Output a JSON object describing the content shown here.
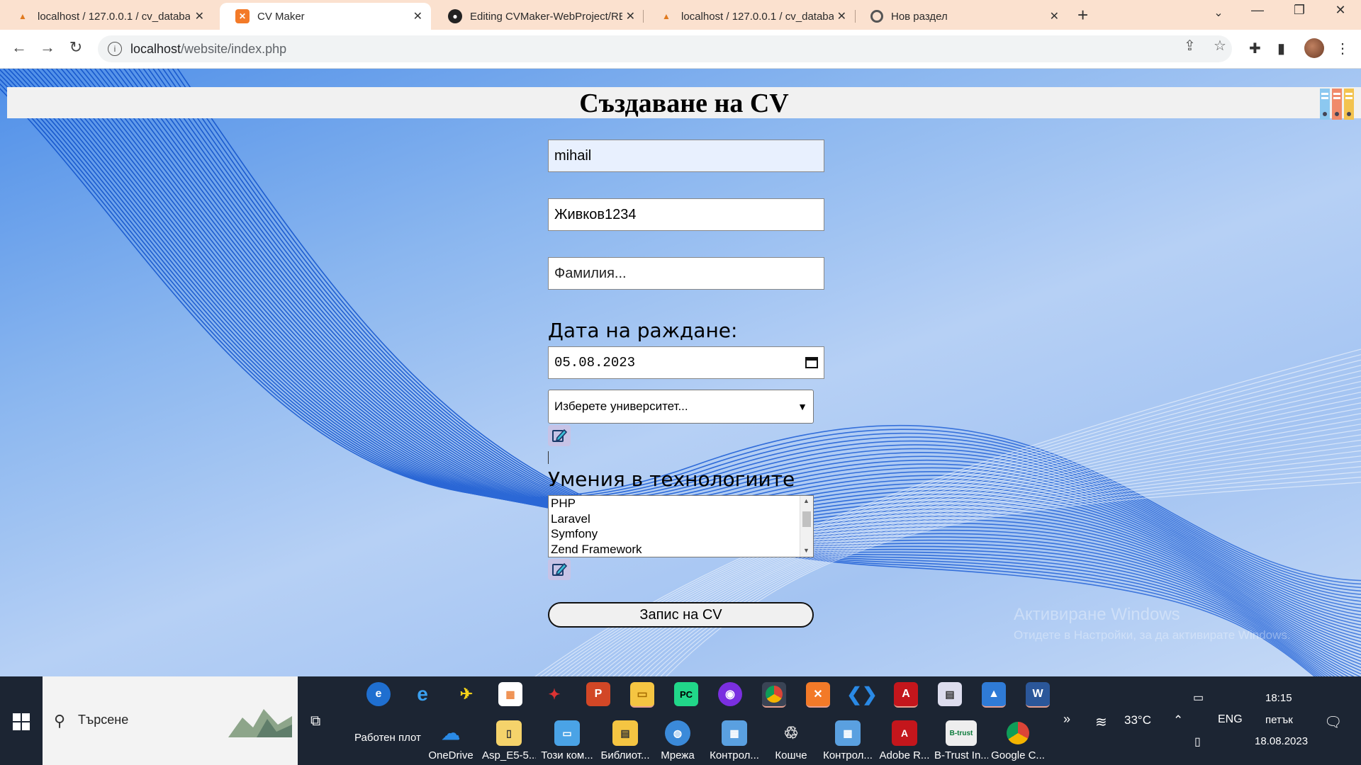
{
  "browser": {
    "tabs": [
      {
        "label": "localhost / 127.0.0.1 / cv_databas",
        "icon": "phpmyadmin-icon"
      },
      {
        "label": "CV Maker",
        "icon": "xampp-icon"
      },
      {
        "label": "Editing CVMaker-WebProject/RE",
        "icon": "github-icon"
      },
      {
        "label": "localhost / 127.0.0.1 / cv_databas",
        "icon": "phpmyadmin-icon"
      },
      {
        "label": "Нов раздел",
        "icon": "chrome-icon"
      }
    ],
    "url_host": "localhost",
    "url_path": "/website/index.php"
  },
  "page": {
    "title": "Създаване на CV",
    "first_name_value": "mihail",
    "middle_name_value": "Живков1234",
    "last_name_placeholder": "Фамилия...",
    "birth_label": "Дата на раждане:",
    "birth_value": "05.08.2023",
    "university_placeholder": "Изберете университет...",
    "skills_label": "Умения в технологиите",
    "skills": [
      "PHP",
      "Laravel",
      "Symfony",
      "Zend Framework"
    ],
    "submit_label": "Запис на CV",
    "watermark_title": "Активиране Windows",
    "watermark_sub": "Отидете в Настройки, за да активирате Windows."
  },
  "taskbar": {
    "search_placeholder": "Търсене",
    "desktop_label": "Работен плот",
    "desktop_apps": [
      "OneDrive",
      "Asp_E5-5...",
      "Този ком...",
      "Библиот...",
      "Мрежа",
      "Контрол...",
      "Кошче",
      "Контрол...",
      "Adobe R...",
      "B-Trust In...",
      "Google C..."
    ],
    "weather": "33°C",
    "language": "ENG",
    "time": "18:15",
    "day": "петък",
    "date": "18.08.2023"
  }
}
